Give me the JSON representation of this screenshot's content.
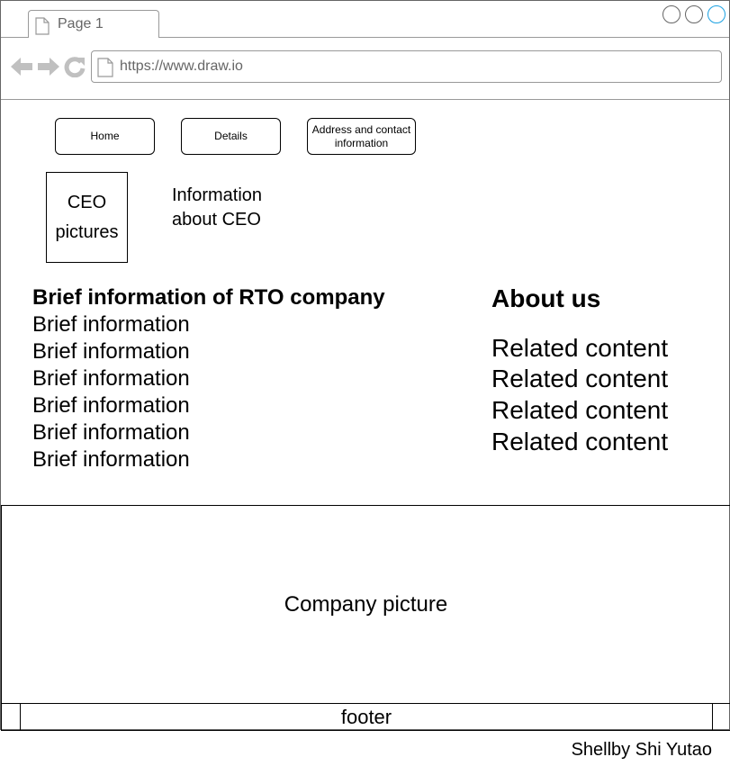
{
  "browser": {
    "tab_label": "Page 1",
    "url": "https://www.draw.io"
  },
  "nav": {
    "home": "Home",
    "details": "Details",
    "address": "Address and contact information"
  },
  "ceo": {
    "picture_label": "CEO pictures",
    "info": "Information about CEO"
  },
  "brief": {
    "title": "Brief information of RTO company",
    "items": [
      "Brief information",
      "Brief information",
      "Brief information",
      "Brief information",
      "Brief information",
      "Brief information"
    ]
  },
  "about": {
    "title": "About us",
    "items": [
      "Related content",
      "Related content",
      "Related content",
      "Related content"
    ]
  },
  "company_picture": "Company picture",
  "footer": "footer",
  "credit": "Shellby Shi Yutao",
  "icons": {
    "tab": "page-icon",
    "back": "arrow-left-icon",
    "forward": "arrow-right-icon",
    "reload": "reload-icon",
    "url": "page-icon"
  },
  "colors": {
    "chrome_gray": "#999999",
    "active_window_button": "#1ba1e2"
  }
}
